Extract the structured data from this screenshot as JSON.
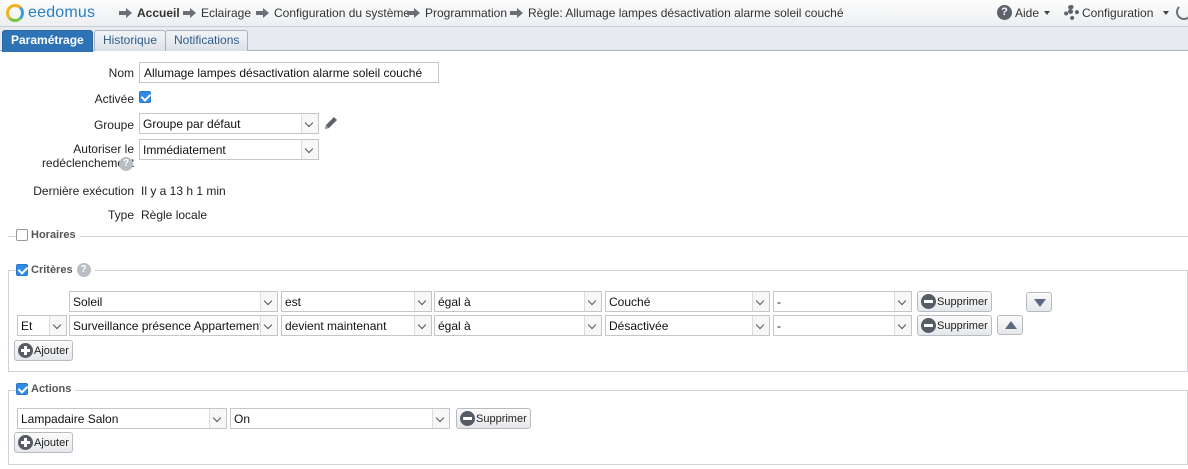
{
  "app": {
    "logo_text": "eedomus"
  },
  "breadcrumb": [
    {
      "label": "Accueil",
      "icon": "arrow-right-icon"
    },
    {
      "label": "Eclairage",
      "icon": "arrow-right-icon"
    },
    {
      "label": "Configuration du système",
      "icon": "arrow-right-icon"
    },
    {
      "label": "Programmation",
      "icon": "arrow-right-icon"
    },
    {
      "label": "Règle: Allumage lampes désactivation alarme soleil couché",
      "icon": "arrow-right-icon"
    }
  ],
  "header": {
    "help_label": "Aide",
    "config_label": "Configuration"
  },
  "tabs": [
    {
      "label": "Paramétrage",
      "active": true
    },
    {
      "label": "Historique",
      "active": false
    },
    {
      "label": "Notifications",
      "active": false
    }
  ],
  "form": {
    "name_label": "Nom",
    "name_value": "Allumage lampes désactivation alarme soleil couché",
    "active_label": "Activée",
    "active_checked": true,
    "group_label": "Groupe",
    "group_value": "Groupe par défaut",
    "retrigger_label_1": "Autoriser le",
    "retrigger_label_2": "redéclenchement",
    "retrigger_value": "Immédiatement",
    "last_exec_label": "Dernière exécution",
    "last_exec_value": "Il y a 13 h 1 min",
    "type_label": "Type",
    "type_value": "Règle locale"
  },
  "horaires": {
    "legend": "Horaires",
    "checked": false
  },
  "criteres": {
    "legend": "Critères",
    "checked": true,
    "rows": [
      {
        "op": "",
        "device": "Soleil",
        "verb": "est",
        "comp": "égal à",
        "value": "Couché",
        "extra": "-",
        "delete": "Supprimer"
      },
      {
        "op": "Et",
        "device": "Surveillance présence Appartement",
        "verb": "devient maintenant",
        "comp": "égal à",
        "value": "Désactivée",
        "extra": "-",
        "delete": "Supprimer"
      }
    ],
    "add_label": "Ajouter"
  },
  "actions": {
    "legend": "Actions",
    "checked": true,
    "rows": [
      {
        "device": "Lampadaire Salon",
        "value": "On",
        "delete": "Supprimer"
      }
    ],
    "add_label": "Ajouter"
  },
  "colors": {
    "accent": "#2f73b7",
    "checkbox": "#2f8be6"
  }
}
